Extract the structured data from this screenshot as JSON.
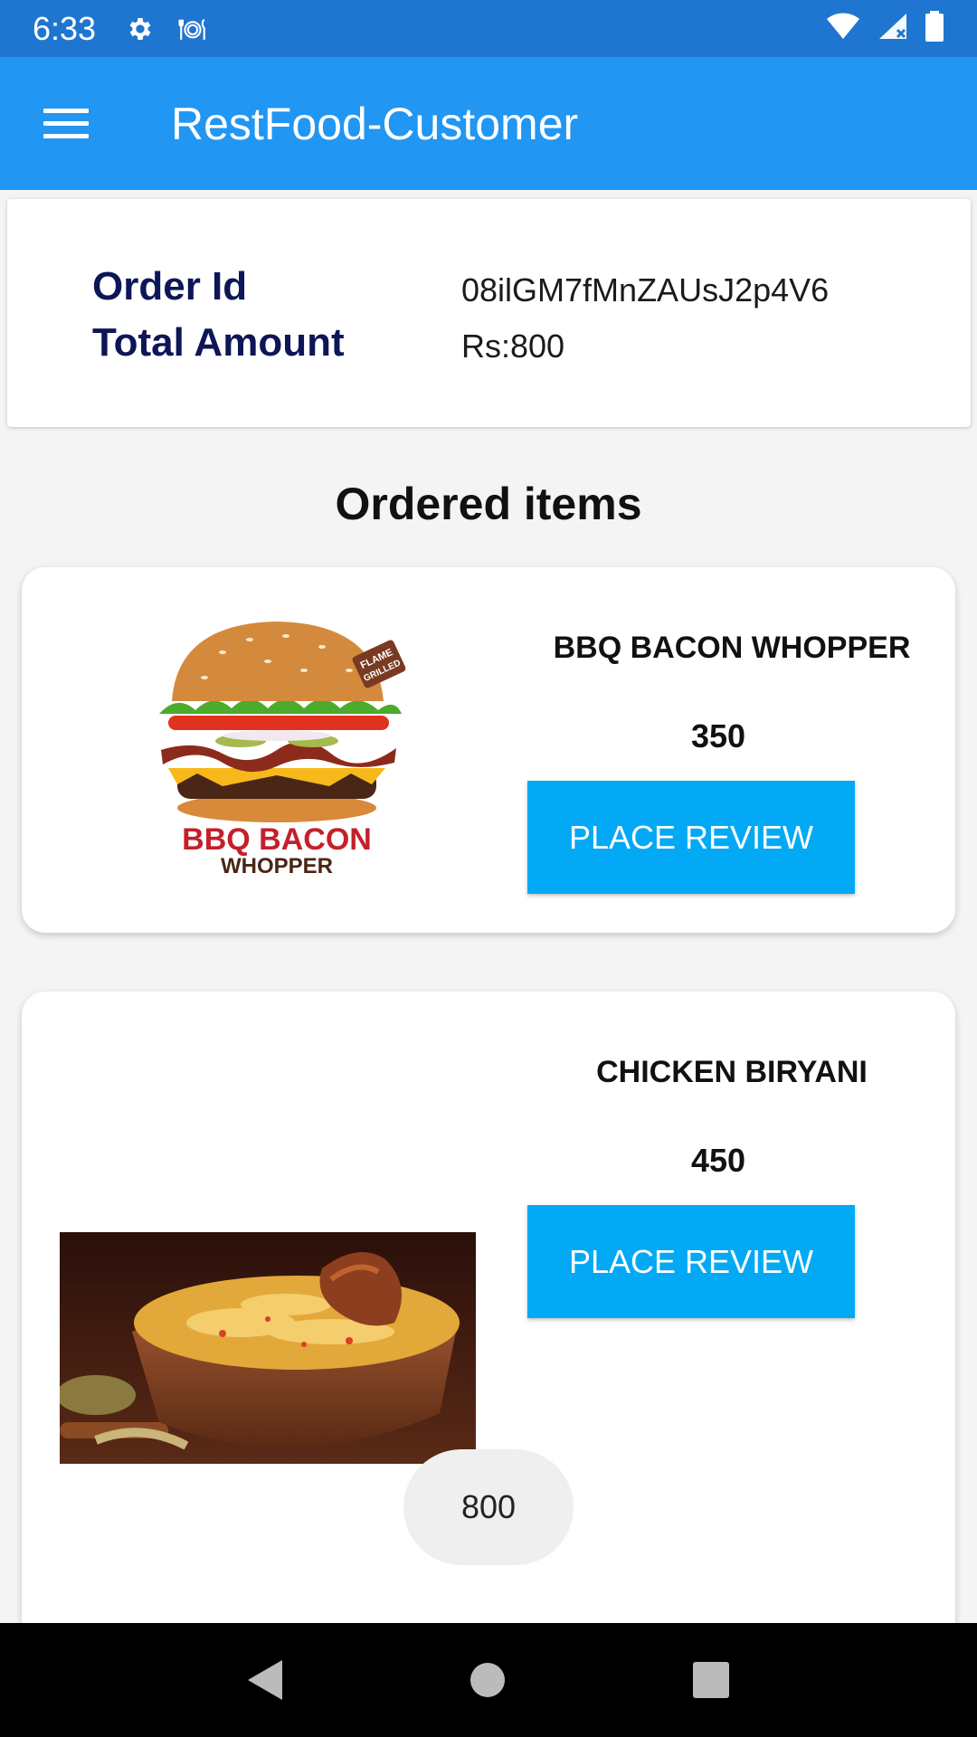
{
  "status_bar": {
    "time": "6:33",
    "icons": [
      "gear-icon",
      "restaurant-icon",
      "wifi-icon",
      "signal-icon",
      "battery-icon"
    ]
  },
  "app_bar": {
    "title": "RestFood-Customer",
    "menu_icon": "hamburger-menu-icon"
  },
  "order": {
    "id_label": "Order Id",
    "id_value": "08ilGM7fMnZAUsJ2p4V6",
    "total_label": "Total Amount",
    "total_value": "Rs:800"
  },
  "section_title": "Ordered items",
  "items": [
    {
      "name": "BBQ BACON WHOPPER",
      "price": "350",
      "button_label": "PLACE REVIEW",
      "image_text_line1": "BBQ BACON",
      "image_text_line2": "WHOPPER",
      "image_badge_line1": "FLAME",
      "image_badge_line2": "GRILLED"
    },
    {
      "name": "CHICKEN BIRYANI",
      "price": "450",
      "button_label": "PLACE REVIEW"
    }
  ],
  "total_chip": "800",
  "colors": {
    "status_bar": "#1f76d0",
    "app_bar": "#2196f3",
    "button": "#03a9f4",
    "label_navy": "#0d1656"
  }
}
